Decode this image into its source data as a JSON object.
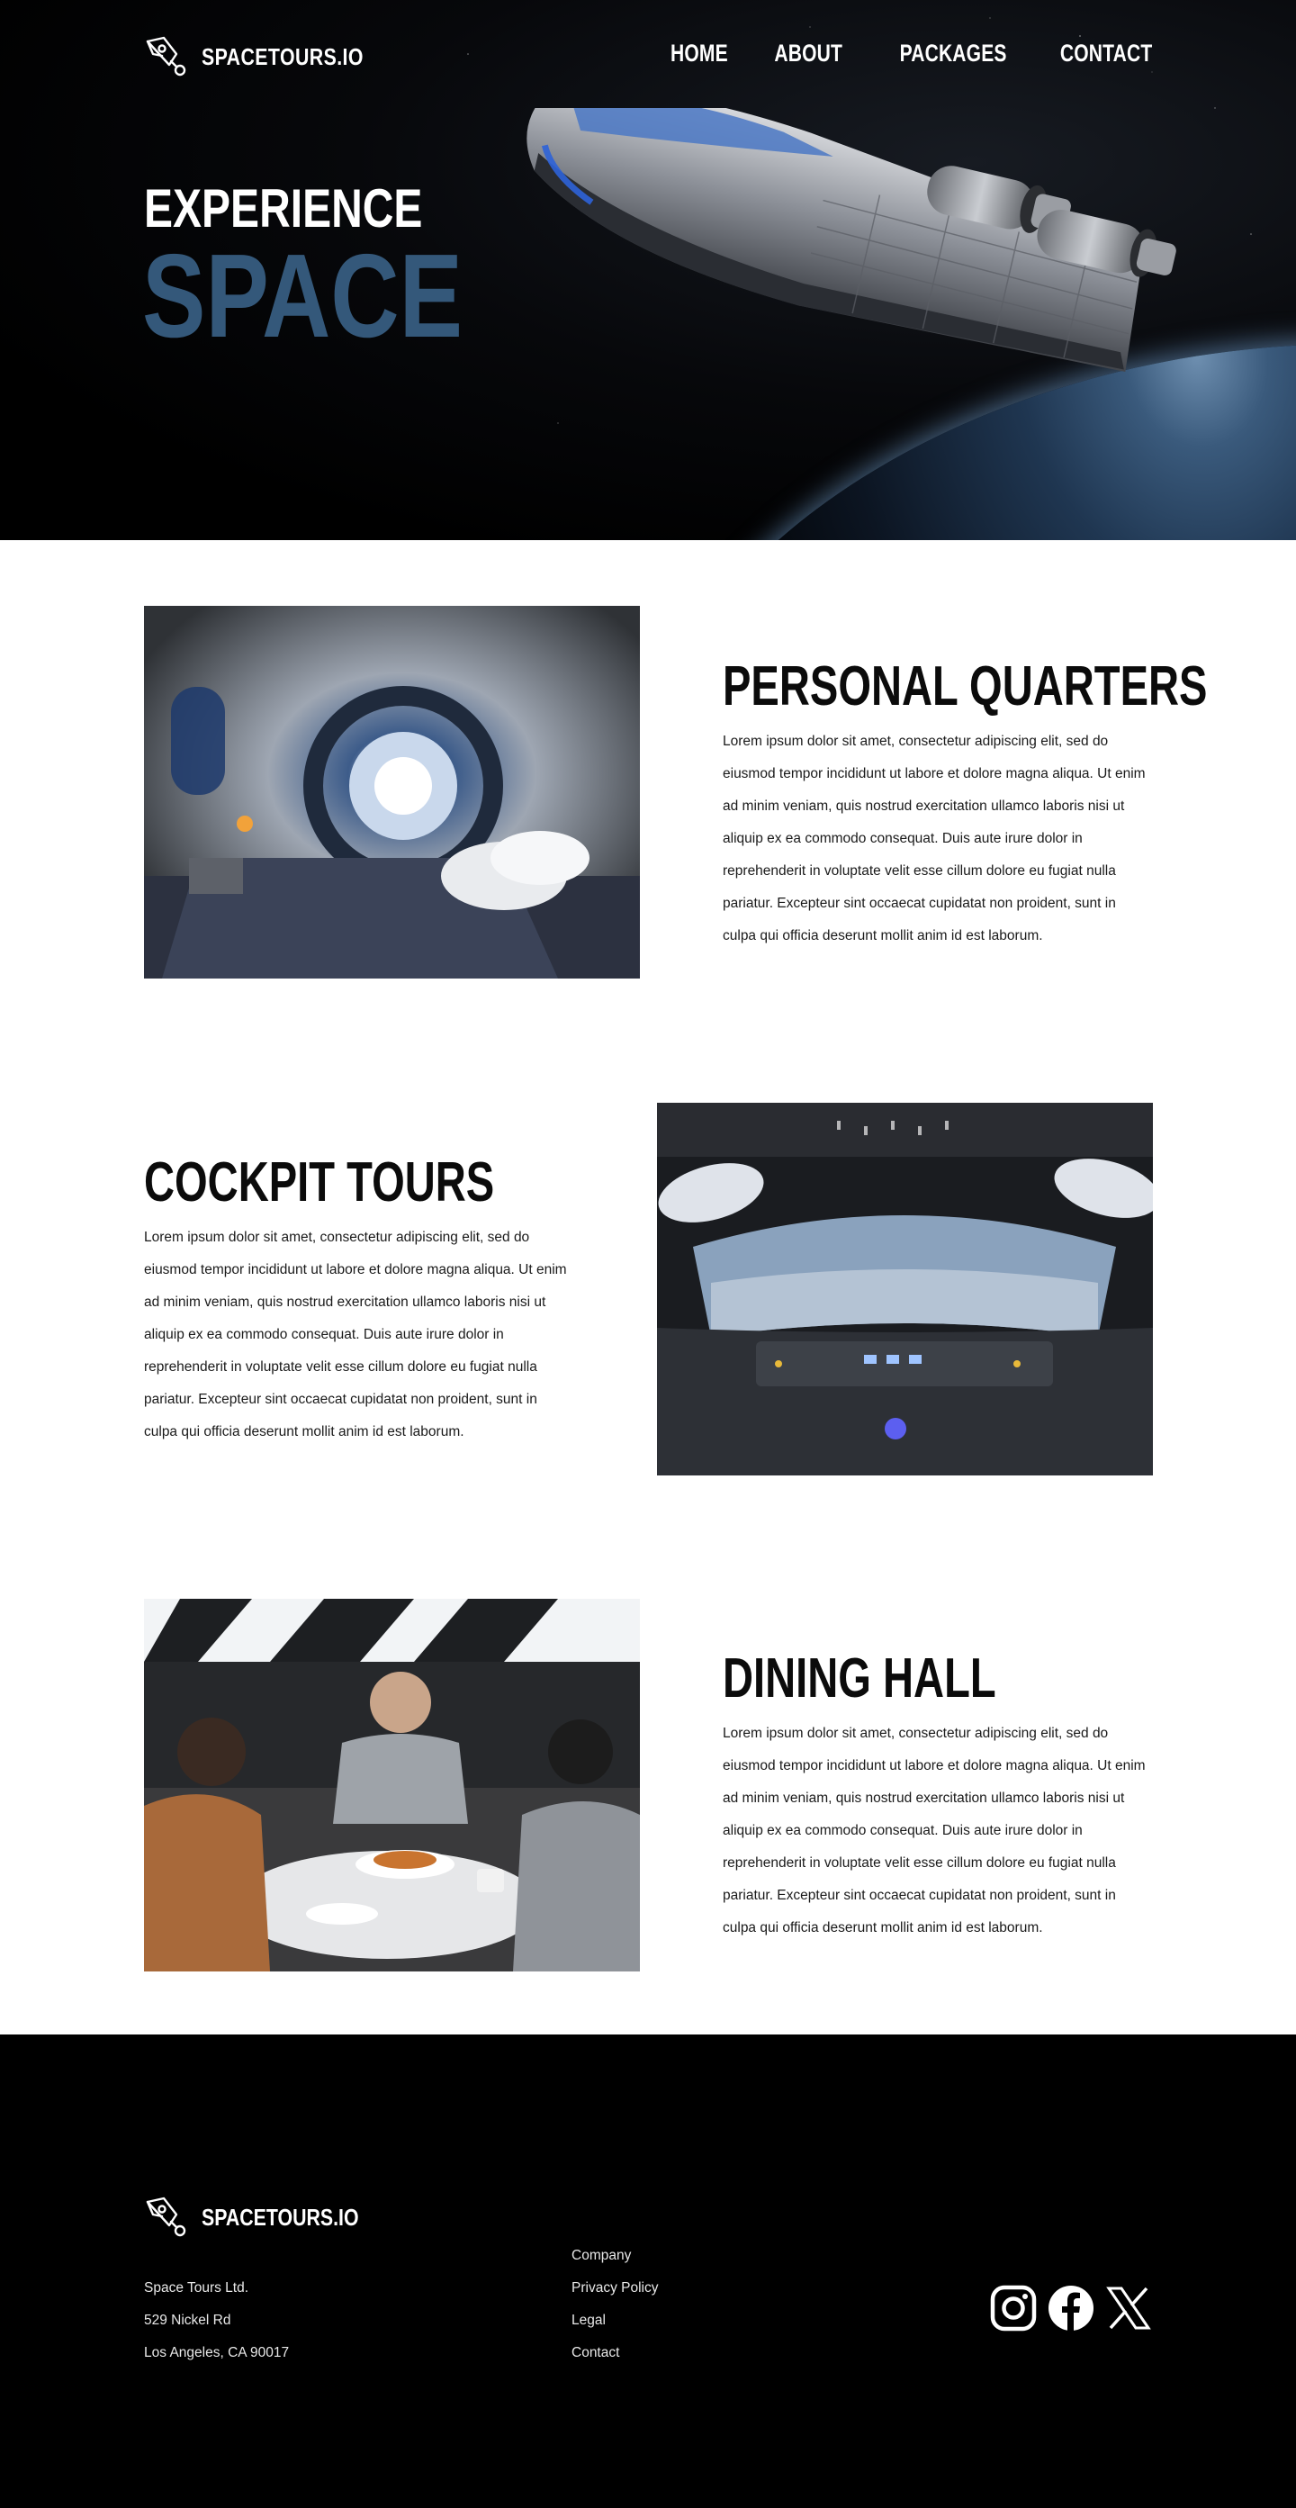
{
  "brand": {
    "name": "SPACETOURS.IO",
    "logo_icon": "rocket-icon"
  },
  "nav": {
    "items": [
      {
        "label": "HOME"
      },
      {
        "label": "ABOUT"
      },
      {
        "label": "PACKAGES"
      },
      {
        "label": "CONTACT"
      }
    ]
  },
  "hero": {
    "title_line1": "EXPERIENCE",
    "title_line2": "SPACE",
    "accent_color": "#34587a",
    "image": "spaceship-over-earth"
  },
  "features": [
    {
      "title": "PERSONAL QUARTERS",
      "image": "spaceship-bedroom-cabin",
      "body": "Lorem ipsum dolor sit amet, consectetur adipiscing elit, sed do eiusmod tempor incididunt ut labore et dolore magna aliqua. Ut enim ad minim veniam, quis nostrud exercitation ullamco laboris nisi ut aliquip ex ea commodo consequat. Duis aute irure dolor in reprehenderit in voluptate velit esse cillum dolore eu fugiat nulla pariatur. Excepteur sint occaecat cupidatat non proident, sunt in culpa qui officia deserunt mollit anim id est laborum."
    },
    {
      "title": "COCKPIT TOURS",
      "image": "spaceship-cockpit",
      "body": "Lorem ipsum dolor sit amet, consectetur adipiscing elit, sed do eiusmod tempor incididunt ut labore et dolore magna aliqua. Ut enim ad minim veniam, quis nostrud exercitation ullamco laboris nisi ut aliquip ex ea commodo consequat. Duis aute irure dolor in reprehenderit in voluptate velit esse cillum dolore eu fugiat nulla pariatur. Excepteur sint occaecat cupidatat non proident, sunt in culpa qui officia deserunt mollit anim id est laborum."
    },
    {
      "title": "DINING HALL",
      "image": "dining-hall-people",
      "body": "Lorem ipsum dolor sit amet, consectetur adipiscing elit, sed do eiusmod tempor incididunt ut labore et dolore magna aliqua. Ut enim ad minim veniam, quis nostrud exercitation ullamco laboris nisi ut aliquip ex ea commodo consequat. Duis aute irure dolor in reprehenderit in voluptate velit esse cillum dolore eu fugiat nulla pariatur. Excepteur sint occaecat cupidatat non proident, sunt in culpa qui officia deserunt mollit anim id est laborum."
    }
  ],
  "footer": {
    "brand": "SPACETOURS.IO",
    "address": [
      "Space Tours Ltd.",
      "529 Nickel Rd",
      "Los Angeles, CA 90017"
    ],
    "links": [
      {
        "label": "Company"
      },
      {
        "label": "Privacy Policy"
      },
      {
        "label": "Legal"
      },
      {
        "label": "Contact"
      }
    ],
    "social": [
      "instagram-icon",
      "facebook-icon",
      "x-icon"
    ]
  }
}
